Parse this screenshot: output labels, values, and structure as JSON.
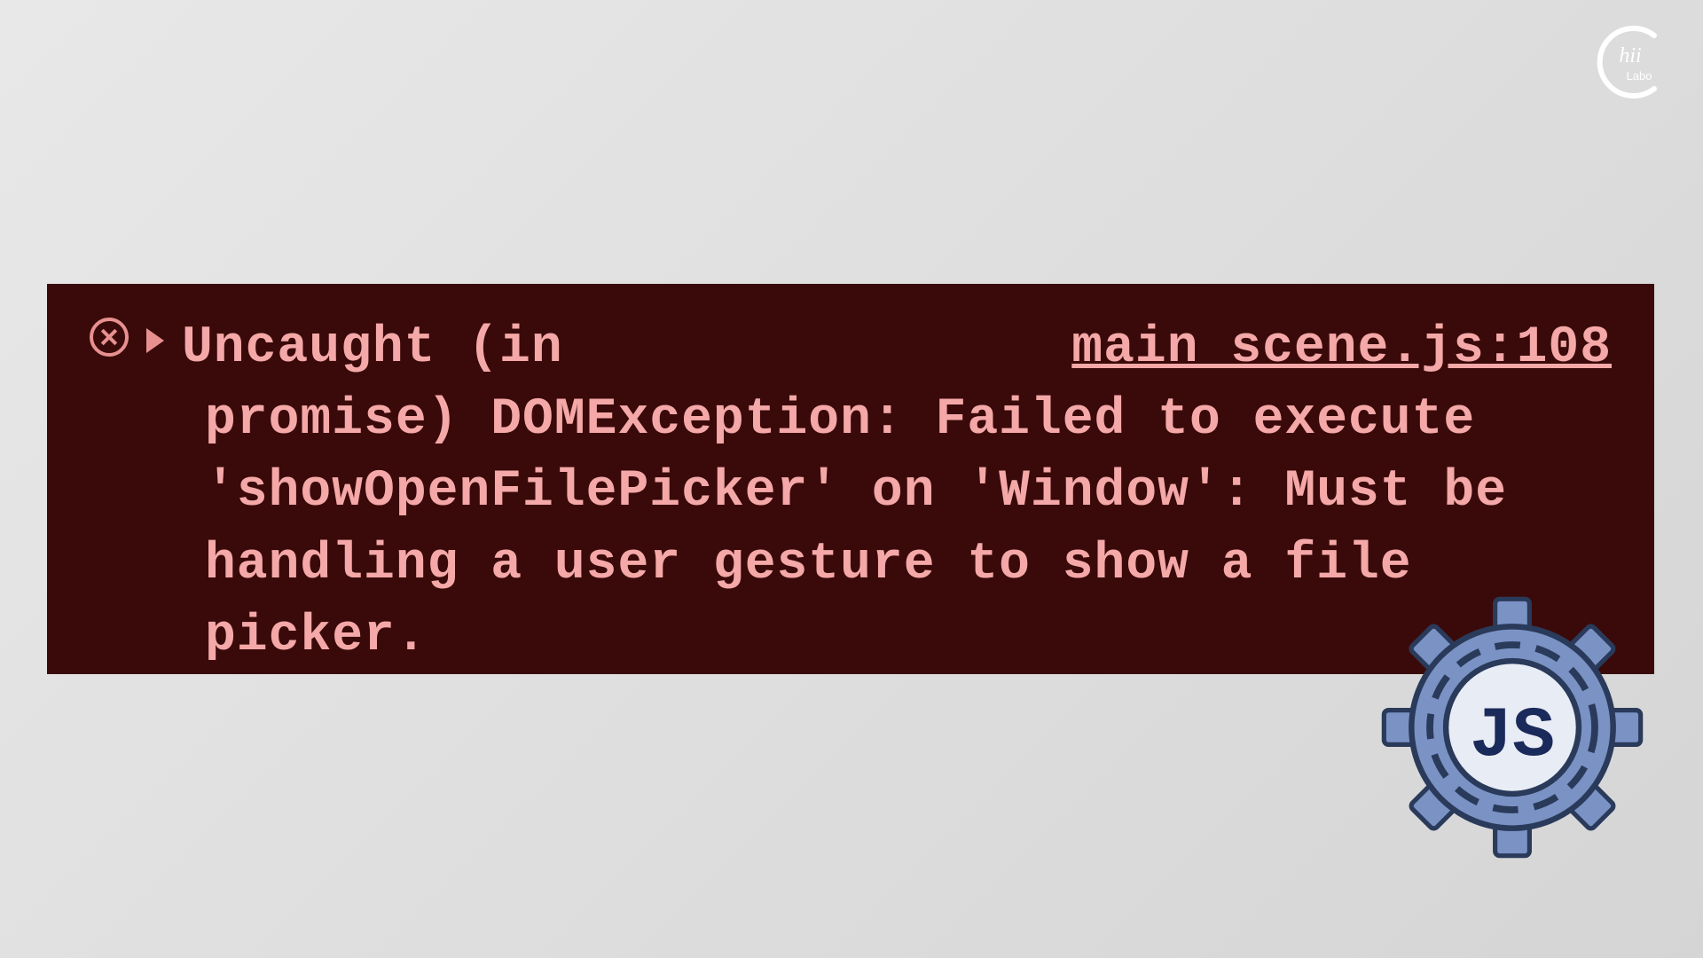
{
  "logo": {
    "brand_text": "hii",
    "sub_text": "Labo"
  },
  "console_error": {
    "first_line_text": "Uncaught (in",
    "source_link": "main scene.js:108",
    "message_continuation": "promise) DOMException: Failed to execute 'showOpenFilePicker' on 'Window': Must be handling a user gesture to show a file picker."
  },
  "js_badge": {
    "label": "JS"
  }
}
